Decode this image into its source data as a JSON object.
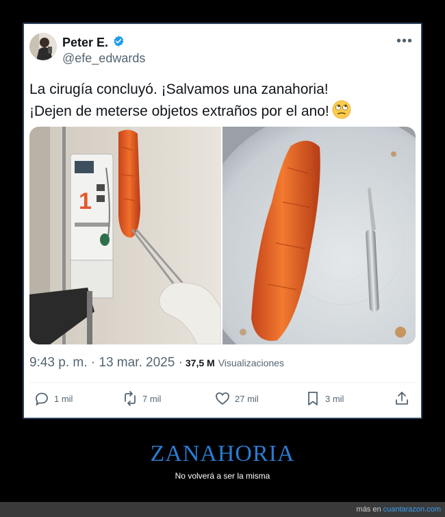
{
  "tweet": {
    "display_name": "Peter E.",
    "handle": "@efe_edwards",
    "text_line1": "La cirugía concluyó. ¡Salvamos una zanahoria!",
    "text_line2": "¡Dejen de meterse objetos extraños por el ano!",
    "emoji": "face-with-rolling-eyes",
    "timestamp": "9:43 p. m. · 13 mar. 2025 ·",
    "views_count": "37,5 M",
    "views_label": "Visualizaciones",
    "media": [
      {
        "description_icon": "photo-carrot-held-by-forceps"
      },
      {
        "description_icon": "photo-carrot-on-tray-with-scalpel"
      }
    ],
    "actions": {
      "replies": "1 mil",
      "reposts": "7 mil",
      "likes": "27 mil",
      "bookmarks": "3 mil"
    }
  },
  "caption": {
    "title": "ZANAHORIA",
    "subtitle": "No volverá a ser la misma"
  },
  "footer": {
    "prefix": "más en",
    "link": "cuantarazon.com"
  },
  "colors": {
    "accent": "#2b7cd3",
    "verified": "#1d9bf0",
    "link": "#3a9cf0"
  }
}
